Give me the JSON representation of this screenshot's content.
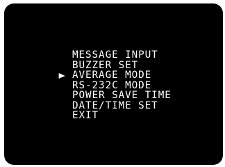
{
  "menu": {
    "selected_index": 2,
    "items": [
      {
        "label": "MESSAGE INPUT"
      },
      {
        "label": "BUZZER SET"
      },
      {
        "label": "AVERAGE MODE"
      },
      {
        "label": "RS-232C MODE"
      },
      {
        "label": "POWER SAVE TIME"
      },
      {
        "label": "DATE/TIME SET"
      },
      {
        "label": "EXIT"
      }
    ]
  },
  "colors": {
    "screen_background": "#000000",
    "text": "#ffffff",
    "frame": "#ffffff"
  },
  "icons": {
    "selection_cursor": "triangle-right-icon"
  }
}
